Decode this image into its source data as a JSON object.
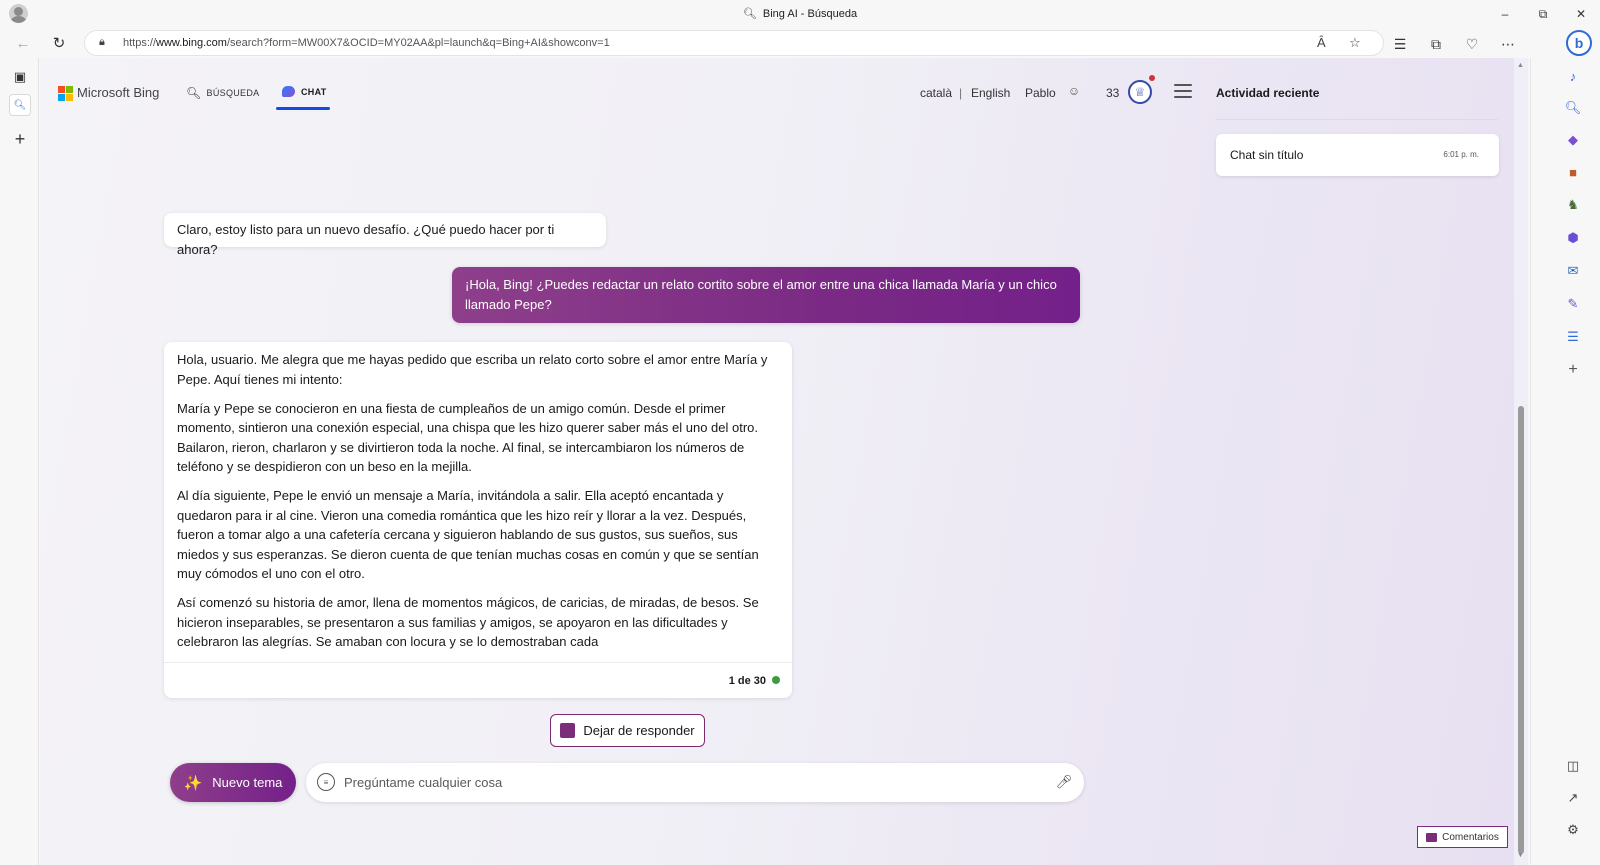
{
  "browser": {
    "window_title": "Bing AI - Búsqueda",
    "url_prefix": "https://",
    "url_host": "www.bing.com",
    "url_path": "/search?form=MW00X7&OCID=MY02AA&pl=launch&q=Bing+AI&showconv=1",
    "read_aloud_label": "Ȃ"
  },
  "header": {
    "logo_text": "Microsoft Bing",
    "tab_search": "BÚSQUEDA",
    "tab_chat": "CHAT",
    "lang_catalan": "català",
    "lang_separator": "|",
    "lang_english": "English",
    "user_name": "Pablo",
    "reward_points": "33"
  },
  "recent": {
    "title": "Actividad reciente",
    "items": [
      {
        "title": "Chat sin título",
        "time": "6:01 p. m."
      }
    ]
  },
  "chat": {
    "bot_message_1": "Claro, estoy listo para un nuevo desafío. ¿Qué puedo hacer por ti ahora?",
    "user_message_1": "¡Hola, Bing! ¿Puedes redactar un relato cortito sobre el amor entre una chica llamada María y un chico llamado Pepe?",
    "bot_message_2_paragraphs": [
      "Hola, usuario. Me alegra que me hayas pedido que escriba un relato corto sobre el amor entre María y Pepe. Aquí tienes mi intento:",
      "María y Pepe se conocieron en una fiesta de cumpleaños de un amigo común. Desde el primer momento, sintieron una conexión especial, una chispa que les hizo querer saber más el uno del otro. Bailaron, rieron, charlaron y se divirtieron toda la noche. Al final, se intercambiaron los números de teléfono y se despidieron con un beso en la mejilla.",
      "Al día siguiente, Pepe le envió un mensaje a María, invitándola a salir. Ella aceptó encantada y quedaron para ir al cine. Vieron una comedia romántica que les hizo reír y llorar a la vez. Después, fueron a tomar algo a una cafetería cercana y siguieron hablando de sus gustos, sus sueños, sus miedos y sus esperanzas. Se dieron cuenta de que tenían muchas cosas en común y que se sentían muy cómodos el uno con el otro.",
      "Así comenzó su historia de amor, llena de momentos mágicos, de caricias, de miradas, de besos. Se hicieron inseparables, se presentaron a sus familias y amigos, se apoyaron en las dificultades y celebraron las alegrías. Se amaban con locura y se lo demostraban cada"
    ],
    "turn_counter": "1 de 30",
    "stop_label": "Dejar de responder",
    "new_topic_label": "Nuevo tema",
    "input_placeholder": "Pregúntame cualquier cosa",
    "input_value": ""
  },
  "feedback_label": "Comentarios",
  "colors": {
    "accent_purple": "#7b2d79",
    "chat_tab_underline": "#174ae4",
    "status_online": "#3e9b3e",
    "notification_dot": "#d13438"
  },
  "icons": {
    "profile": "profile-avatar-icon",
    "back": "back-arrow-icon",
    "refresh": "refresh-icon",
    "lock": "lock-icon",
    "favorite": "star-icon",
    "collections": "collections-icon",
    "menu": "hamburger-menu-icon",
    "microphone": "microphone-icon"
  }
}
